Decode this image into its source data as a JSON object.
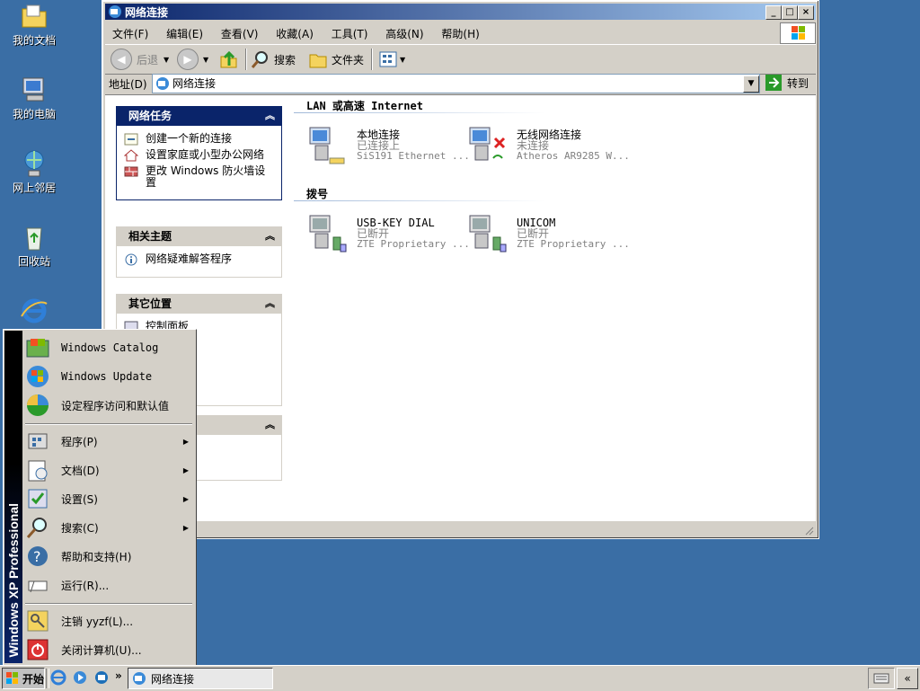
{
  "desktop": {
    "icons": [
      {
        "label": "我的文档",
        "icon": "folder-documents-icon"
      },
      {
        "label": "我的电脑",
        "icon": "computer-icon"
      },
      {
        "label": "网上邻居",
        "icon": "network-places-icon"
      },
      {
        "label": "回收站",
        "icon": "recycle-bin-icon"
      },
      {
        "label": "",
        "icon": "internet-explorer-icon"
      }
    ]
  },
  "window": {
    "title": "网络连接",
    "menu": [
      "文件(F)",
      "编辑(E)",
      "查看(V)",
      "收藏(A)",
      "工具(T)",
      "高级(N)",
      "帮助(H)"
    ],
    "toolbar": {
      "back": "后退",
      "search": "搜索",
      "folders": "文件夹"
    },
    "address": {
      "label": "地址(D)",
      "value": "网络连接",
      "go": "转到"
    },
    "tasks": {
      "network_tasks": {
        "title": "网络任务",
        "items": [
          "创建一个新的连接",
          "设置家庭或小型办公网络",
          "更改 Windows 防火墙设置"
        ]
      },
      "related": {
        "title": "相关主题",
        "items": [
          "网络疑难解答程序"
        ]
      },
      "other_places": {
        "title": "其它位置",
        "items": [
          "控制面板"
        ]
      }
    },
    "sections": {
      "lan": {
        "title": "LAN 或高速 Internet",
        "items": [
          {
            "name": "本地连接",
            "status": "已连接上",
            "device": "SiS191 Ethernet ..."
          },
          {
            "name": "无线网络连接",
            "status": "未连接",
            "device": "Atheros AR9285 W..."
          }
        ]
      },
      "dialup": {
        "title": "拨号",
        "items": [
          {
            "name": "USB-KEY DIAL",
            "status": "已断开",
            "device": "ZTE Proprietary ..."
          },
          {
            "name": "UNICOM",
            "status": "已断开",
            "device": "ZTE Proprietary ..."
          }
        ]
      }
    }
  },
  "startmenu": {
    "band_text": "Windows XP Professional",
    "top": [
      "Windows Catalog",
      "Windows Update",
      "设定程序访问和默认值"
    ],
    "middle": [
      "程序(P)",
      "文档(D)",
      "设置(S)",
      "搜索(C)",
      "帮助和支持(H)",
      "运行(R)..."
    ],
    "bottom": [
      "注销 yyzf(L)...",
      "关闭计算机(U)..."
    ]
  },
  "taskbar": {
    "start": "开始",
    "task": "网络连接",
    "chevron": "»"
  },
  "colors": {
    "desktop": "#3a6ea5",
    "titlebar_active": "#0a246a",
    "face": "#d4d0c8"
  }
}
